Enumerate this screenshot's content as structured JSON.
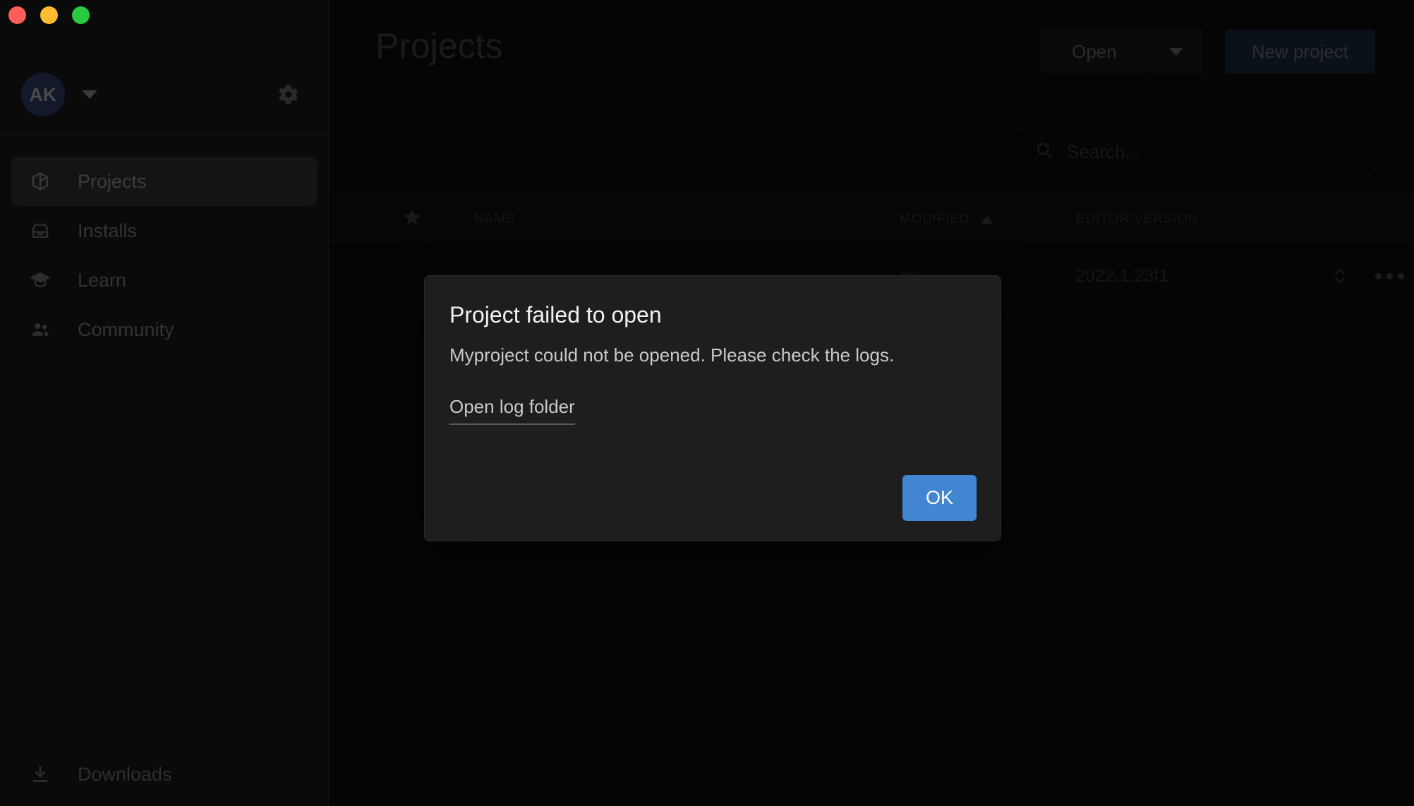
{
  "window": {
    "traffic_lights": [
      {
        "name": "close",
        "color": "#ff5f57"
      },
      {
        "name": "minimize",
        "color": "#febc2e"
      },
      {
        "name": "maximize",
        "color": "#28c840"
      }
    ]
  },
  "sidebar": {
    "account": {
      "initials": "AK",
      "dropdown_icon": "chevron-down-icon"
    },
    "settings_icon": "gear-icon",
    "items": [
      {
        "label": "Projects",
        "icon": "cube-icon",
        "active": true
      },
      {
        "label": "Installs",
        "icon": "toolbox-icon",
        "active": false
      },
      {
        "label": "Learn",
        "icon": "graduation-cap-icon",
        "active": false
      },
      {
        "label": "Community",
        "icon": "people-icon",
        "active": false
      }
    ],
    "footer": {
      "label": "Downloads",
      "icon": "download-icon"
    }
  },
  "header": {
    "title": "Projects",
    "open_label": "Open",
    "open_dropdown_icon": "chevron-down-icon",
    "new_project_label": "New project"
  },
  "search": {
    "placeholder": "Search...",
    "value": "",
    "icon": "search-icon"
  },
  "table": {
    "columns": [
      {
        "key": "favorite",
        "label": "",
        "icon": "star-icon"
      },
      {
        "key": "name",
        "label": "NAME"
      },
      {
        "key": "modified",
        "label": "MODIFIED",
        "sort": "asc",
        "sort_icon": "caret-up-icon"
      },
      {
        "key": "editor_version",
        "label": "EDITOR VERSION"
      }
    ],
    "rows": [
      {
        "favorite": false,
        "name": "",
        "modified": "go",
        "editor_version": "2022.1.23f1",
        "version_switch_icon": "chevron-up-down-icon",
        "more_icon": "ellipsis-icon"
      }
    ]
  },
  "dialog": {
    "title": "Project failed to open",
    "message": "Myproject could not be opened. Please check the logs.",
    "link_label": "Open log folder",
    "ok_label": "OK",
    "ok_color": "#4285d0"
  },
  "colors": {
    "background": "#09090a",
    "sidebar": "#0a0a0b",
    "dialog": "#1e1e1e",
    "accent_blue": "#4285d0",
    "new_project_blue": "#121e2c",
    "avatar_navy": "#13192a"
  }
}
